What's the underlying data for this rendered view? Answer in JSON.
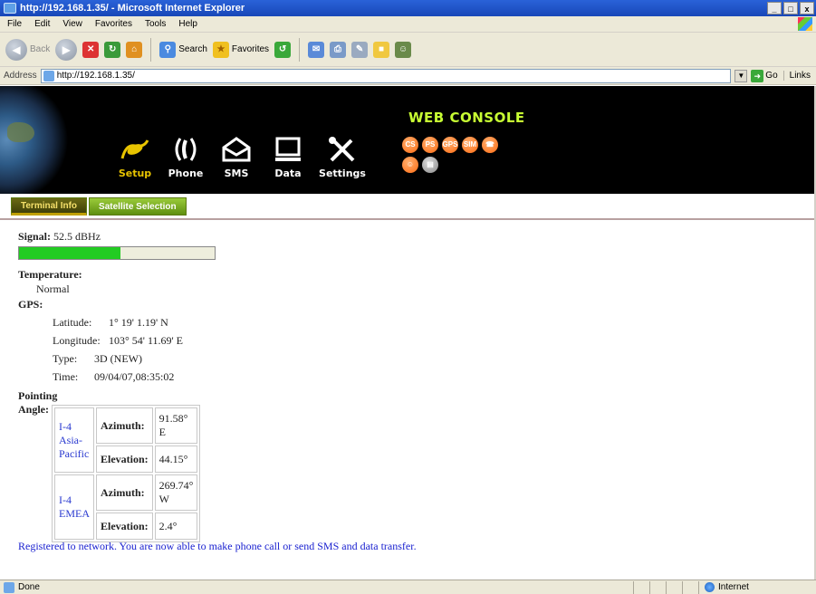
{
  "window": {
    "title": "http://192.168.1.35/ - Microsoft Internet Explorer",
    "buttons": [
      "_",
      "□",
      "x"
    ]
  },
  "menu": [
    "File",
    "Edit",
    "View",
    "Favorites",
    "Tools",
    "Help"
  ],
  "toolbar": {
    "back": "Back",
    "search": "Search",
    "favorites": "Favorites"
  },
  "address": {
    "label": "Address",
    "url": "http://192.168.1.35/",
    "go": "Go",
    "links": "Links"
  },
  "banner": {
    "title": "WEB CONSOLE",
    "nav": [
      {
        "label": "Setup",
        "icon": "satellite-icon"
      },
      {
        "label": "Phone",
        "icon": "phone-icon"
      },
      {
        "label": "SMS",
        "icon": "envelope-icon"
      },
      {
        "label": "Data",
        "icon": "monitor-icon"
      },
      {
        "label": "Settings",
        "icon": "tools-icon"
      }
    ],
    "status_icons": [
      "CS",
      "PS",
      "GPS",
      "SIM",
      "☎",
      "☺",
      "▤"
    ]
  },
  "tabs": [
    "Terminal Info",
    "Satellite Selection"
  ],
  "signal": {
    "label": "Signal:",
    "value": "52.5 dBHz",
    "level": 0.52
  },
  "temperature": {
    "label": "Temperature:",
    "value": "Normal"
  },
  "gps": {
    "label": "GPS:",
    "rows": [
      {
        "key": "Latitude:",
        "value": "1° 19' 1.19' N"
      },
      {
        "key": "Longitude:",
        "value": "103° 54' 11.69' E"
      },
      {
        "key": "Type:",
        "value": "3D (NEW)"
      },
      {
        "key": "Time:",
        "value": "09/04/07,08:35:02"
      }
    ]
  },
  "pointing": {
    "label": "Pointing Angle:",
    "satellites": [
      {
        "name": "I-4 Asia-Pacific",
        "azimuth_label": "Azimuth:",
        "azimuth": "91.58° E",
        "elevation_label": "Elevation:",
        "elevation": "44.15°"
      },
      {
        "name": "I-4 EMEA",
        "azimuth_label": "Azimuth:",
        "azimuth": "269.74° W",
        "elevation_label": "Elevation:",
        "elevation": "2.4°"
      }
    ]
  },
  "message": "Registered to network. You are now able to make phone call or send SMS and data transfer.",
  "statusbar": {
    "text": "Done",
    "zone": "Internet"
  },
  "colors": {
    "accent": "#c8ff33",
    "signal": "#22cc22",
    "message": "#1b22d0"
  }
}
